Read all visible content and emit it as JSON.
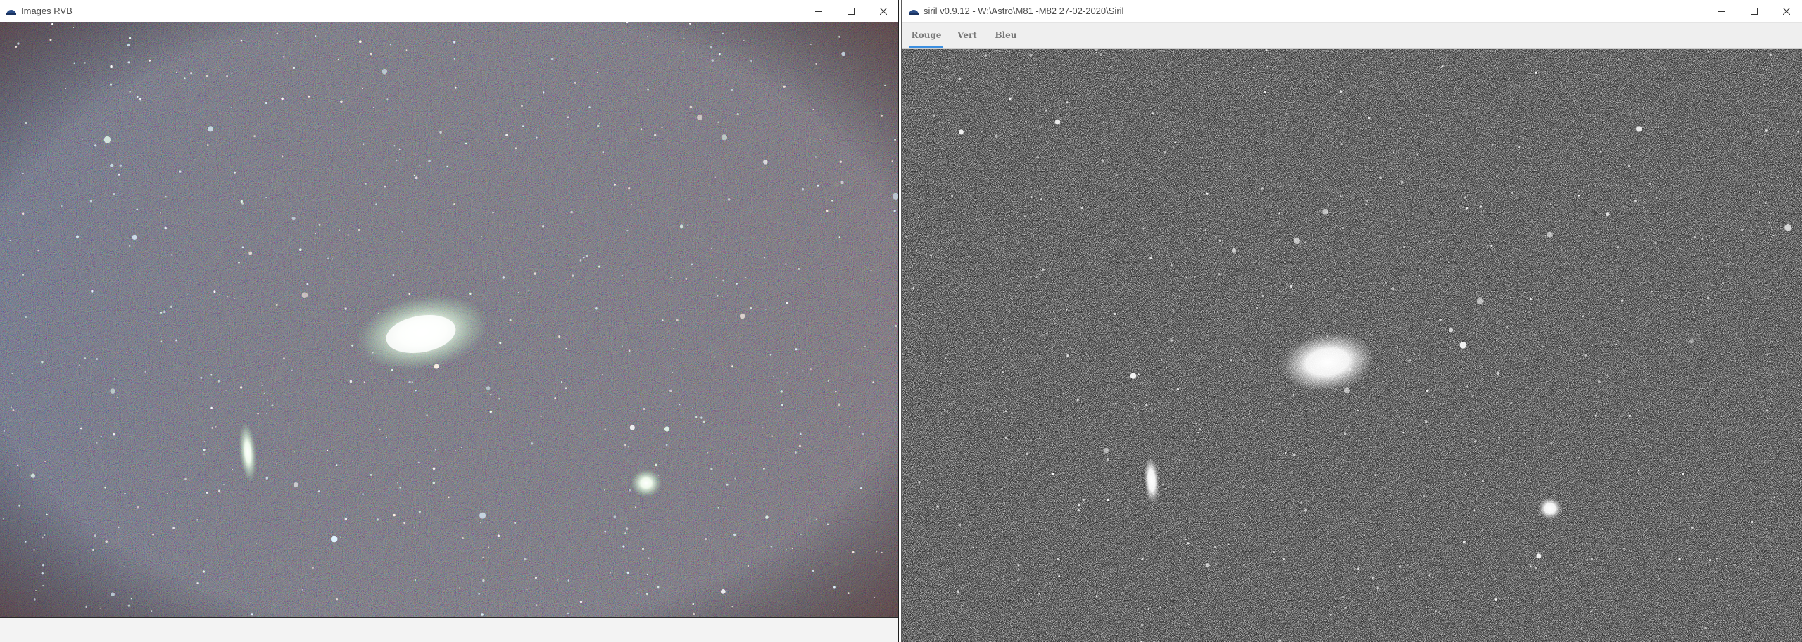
{
  "left_window": {
    "title": "Images RVB",
    "icon": "siril-app-icon",
    "controls": [
      "minimize-icon",
      "maximize-icon",
      "close-icon"
    ]
  },
  "right_window": {
    "title": "siril v0.9.12 - W:\\Astro\\M81 -M82 27-02-2020\\Siril",
    "icon": "siril-app-icon",
    "controls": [
      "minimize-icon",
      "maximize-icon",
      "close-icon"
    ],
    "tabs": [
      {
        "label": "Rouge",
        "active": true
      },
      {
        "label": "Vert",
        "active": false
      },
      {
        "label": "Bleu",
        "active": false
      }
    ]
  },
  "colors": {
    "tab_accent": "#3c8fe0",
    "rgb_background": "#6d6a66",
    "mono_background": "#3a3a3a"
  }
}
